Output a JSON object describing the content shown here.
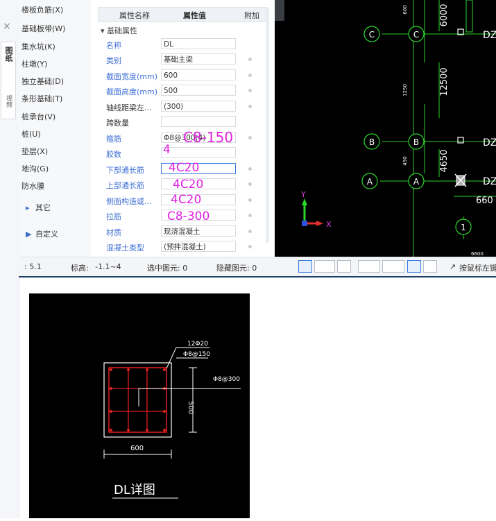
{
  "left_strip": {
    "close_icon": "×",
    "vertical_tab_title": "图纸",
    "vertical_tab_sub": "视频"
  },
  "component_list": {
    "items": [
      "楼板负筋(X)",
      "基础板带(W)",
      "集水坑(K)",
      "柱墩(Y)",
      "独立基础(D)",
      "条形基础(T)",
      "桩承台(V)",
      "桩(U)",
      "垫层(X)",
      "地沟(G)",
      "防水膜"
    ],
    "groups": [
      {
        "label": "其它",
        "icon": "chevron-right-icon"
      },
      {
        "label": "自定义",
        "icon": "triangle-right-icon"
      }
    ]
  },
  "properties": {
    "header": {
      "name": "属性名称",
      "value": "属性值",
      "extra": "附加"
    },
    "group_label": "基础属性",
    "rows": [
      {
        "name": "名称",
        "value": "DL"
      },
      {
        "name": "类别",
        "value": "基础主梁"
      },
      {
        "name": "截面宽度(mm)",
        "value": "600"
      },
      {
        "name": "截面高度(mm)",
        "value": "500"
      },
      {
        "name": "轴线距梁左...",
        "value": "(300)"
      },
      {
        "name": "跨数量",
        "value": ""
      },
      {
        "name": "箍筋",
        "value": "Φ8@300(4)"
      },
      {
        "name": "胶数",
        "value": ""
      },
      {
        "name": "下部通长筋",
        "value": ""
      },
      {
        "name": "上部通长筋",
        "value": ""
      },
      {
        "name": "侧面构造或...",
        "value": ""
      },
      {
        "name": "拉筋",
        "value": ""
      },
      {
        "name": "材质",
        "value": "现浇混凝土"
      },
      {
        "name": "混凝土类型",
        "value": "(预拌混凝土)"
      }
    ],
    "handwritten": {
      "stirrup": "C8-150",
      "legs": "4",
      "bottom": "4C20",
      "top": "4C20",
      "side": "4C20",
      "tie": "C8-300"
    }
  },
  "cad": {
    "grid_labels": {
      "C_left": "C",
      "C_right": "C",
      "B_left": "B",
      "B_right": "B",
      "A_left": "A",
      "A_right": "A",
      "num_1": "1"
    },
    "dims": {
      "d6000": "6000",
      "d12500": "12500",
      "d4650": "4650",
      "d660": "660",
      "small_600": "600",
      "small_1250": "1250",
      "small_450": "450",
      "small_6600": "6600"
    },
    "beam_labels": {
      "dz_c": "DZ",
      "dz_b": "DZ",
      "dz_a": "DZ"
    },
    "axis": {
      "x": "X",
      "y": "Y"
    }
  },
  "status_bar": {
    "scale": ": 5.1",
    "elevation_label": "标高:",
    "elevation_value": "-1.1~4",
    "selected_label": "选中图元: 0",
    "hidden_label": "隐藏图元: 0",
    "mouse_hint": "按鼠标左键"
  },
  "detail": {
    "title": "DL详图",
    "rebar_main": "12Φ20",
    "rebar_stirrup": "Φ8@150",
    "rebar_tie": "Φ8@300",
    "dim_width": "600",
    "dim_height": "500"
  },
  "colors": {
    "accent": "#3b7de0",
    "magenta": "#e020e0",
    "cad_bg": "#000000",
    "cad_green": "#2bd62b"
  }
}
